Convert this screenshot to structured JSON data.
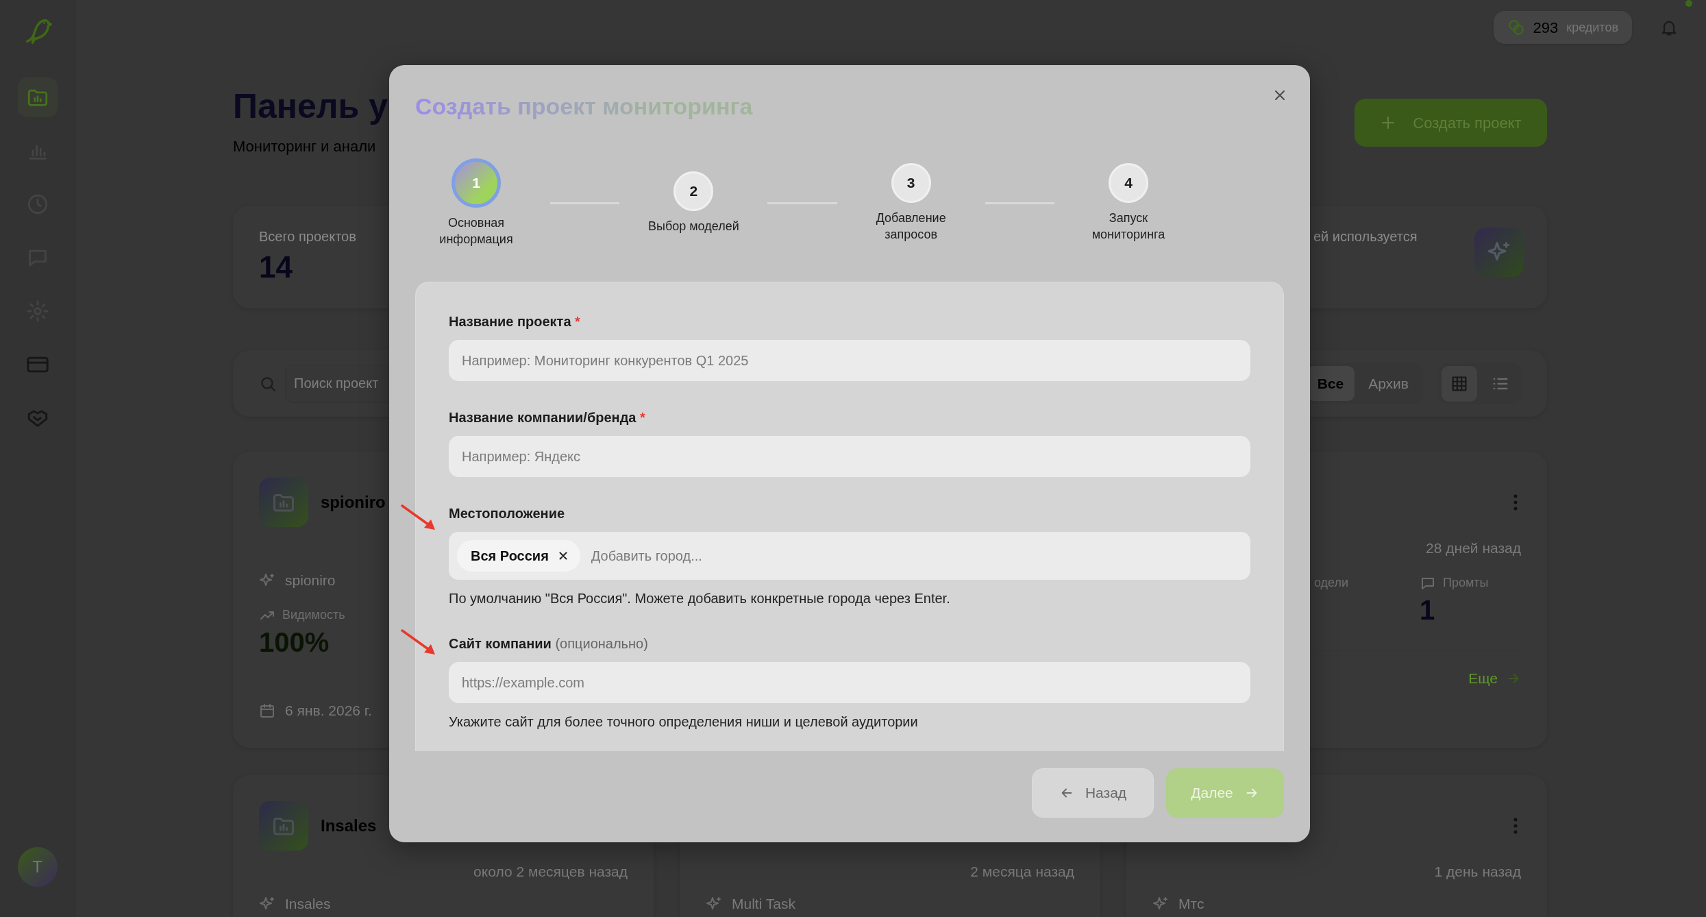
{
  "sidebar": {
    "items": [
      {
        "selected": true
      },
      {
        "selected": false
      },
      {
        "selected": false
      },
      {
        "selected": false
      },
      {
        "selected": false
      },
      {
        "selected": false
      },
      {
        "selected": false
      }
    ],
    "avatar": {
      "initial": "Т"
    }
  },
  "topbar": {
    "credits": {
      "amount": "293",
      "unit": "кредитов"
    },
    "notifications": {
      "unread": true
    }
  },
  "header": {
    "title": "Панель у",
    "subtitle": "Мониторинг и анали",
    "create_button": "Создать проект"
  },
  "stats": [
    {
      "label": "Всего проектов",
      "value": "14"
    },
    {
      "label": "ей используется"
    }
  ],
  "toolbar": {
    "search": {
      "placeholder": "Поиск проект"
    },
    "filters": [
      {
        "label": "Все",
        "selected": true
      },
      {
        "label": "Архив",
        "selected": false
      }
    ],
    "views": [
      {
        "kind": "grid",
        "selected": true
      },
      {
        "kind": "list",
        "selected": false
      }
    ]
  },
  "projects": [
    {
      "title": "spioniro",
      "brand": "spioniro",
      "stats": [
        {
          "kind": "visibility",
          "label": "Видимость",
          "value": "100%"
        }
      ],
      "date": "6 янв. 2026 г."
    },
    {
      "time": "28 дней назад",
      "stats": [
        {
          "kind": "models",
          "label": "одели"
        },
        {
          "kind": "prompts",
          "label": "Промты",
          "value": "1"
        }
      ],
      "more_link": "Еще"
    },
    {
      "title": "Insales",
      "time": "около 2 месяцев назад",
      "brand": "Insales"
    },
    {
      "time": "2 месяца назад",
      "brand": "Multi Task"
    },
    {
      "time": "1 день назад",
      "brand": "Мтс"
    }
  ],
  "modal": {
    "title": "Создать проект мониторинга",
    "steps": [
      {
        "number": "1",
        "label": "Основная информация",
        "selected": true
      },
      {
        "number": "2",
        "label": "Выбор моделей",
        "selected": false
      },
      {
        "number": "3",
        "label": "Добавление запросов",
        "selected": false
      },
      {
        "number": "4",
        "label": "Запуск мониторинга",
        "selected": false
      }
    ],
    "fields": [
      {
        "kind": "text",
        "label": "Название проекта",
        "required_mark": "*",
        "placeholder": "Например: Мониторинг конкурентов Q1 2025"
      },
      {
        "kind": "text",
        "label": "Название компании/бренда",
        "required_mark": "*",
        "placeholder": "Например: Яндекс"
      },
      {
        "kind": "tags",
        "label": "Местоположение",
        "annotated": true,
        "tags": [
          "Вся Россия"
        ],
        "placeholder": "Добавить город...",
        "help": "По умолчанию \"Вся Россия\". Можете добавить конкретные города через Enter."
      },
      {
        "kind": "text",
        "label": "Сайт компании",
        "optional_note": "(опционально)",
        "annotated": true,
        "placeholder": "https://example.com",
        "help": "Укажите сайт для более точного определения ниши и целевой аудитории"
      }
    ],
    "back_button": "Назад",
    "next_button": "Далее"
  }
}
